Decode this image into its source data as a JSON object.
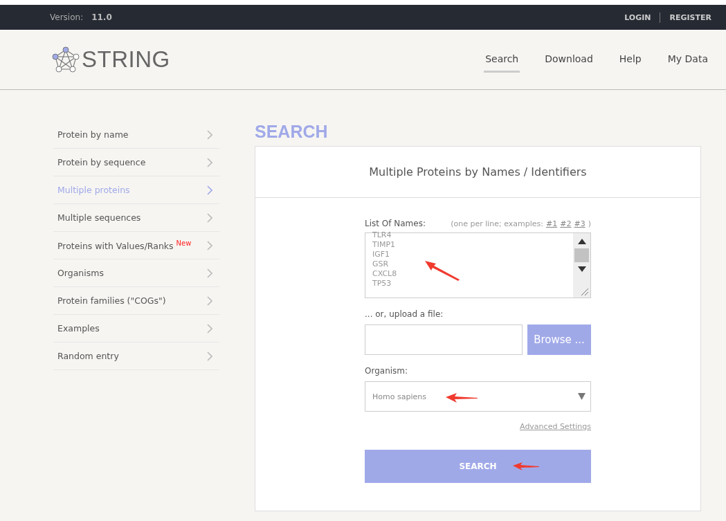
{
  "topbar": {
    "version_label": "Version:",
    "version": "11.0",
    "links": [
      "LOGIN",
      "REGISTER"
    ]
  },
  "header": {
    "logo_text": "STRING",
    "nav": [
      {
        "label": "Search",
        "selected": true
      },
      {
        "label": "Download",
        "selected": false
      },
      {
        "label": "Help",
        "selected": false
      },
      {
        "label": "My Data",
        "selected": false
      }
    ]
  },
  "sidebar": {
    "items": [
      {
        "label": "Protein by name",
        "selected": false
      },
      {
        "label": "Protein by sequence",
        "selected": false
      },
      {
        "label": "Multiple proteins",
        "selected": true
      },
      {
        "label": "Multiple sequences",
        "selected": false
      },
      {
        "label": "Proteins with Values/Ranks",
        "badge": "New",
        "selected": false
      },
      {
        "label": "Organisms",
        "selected": false
      },
      {
        "label": "Protein families (\"COGs\")",
        "selected": false
      },
      {
        "label": "Examples",
        "selected": false
      },
      {
        "label": "Random entry",
        "selected": false
      }
    ]
  },
  "page_title": "SEARCH",
  "card": {
    "title": "Multiple Proteins by Names / Identifiers",
    "names_label": "List Of Names:",
    "names_hint": "(one per line; examples:",
    "examples": [
      "#1",
      "#2",
      "#3"
    ],
    "names_hint_end": ")",
    "names": "TLR4\nTIMP1\nIGF1\nGSR\nCXCL8\nTP53",
    "upload_label": "... or, upload a file:",
    "browse_button": "Browse ...",
    "organism_label": "Organism:",
    "organism": "Homo sapiens",
    "advanced_link": "Advanced Settings",
    "search_button": "SEARCH"
  }
}
